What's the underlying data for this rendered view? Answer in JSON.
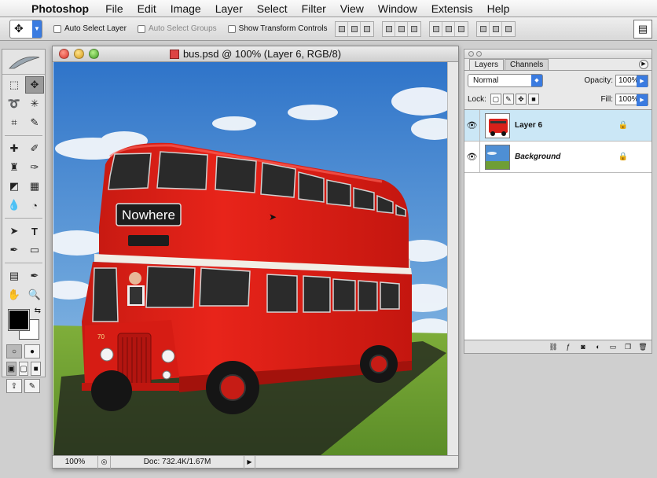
{
  "menubar": {
    "app": "Photoshop",
    "items": [
      "File",
      "Edit",
      "Image",
      "Layer",
      "Select",
      "Filter",
      "View",
      "Window",
      "Extensis",
      "Help"
    ]
  },
  "options": {
    "auto_select_layer": "Auto Select Layer",
    "auto_select_groups": "Auto Select Groups",
    "show_transform_controls": "Show Transform Controls"
  },
  "document": {
    "title": "bus.psd @ 100% (Layer 6, RGB/8)",
    "zoom": "100%",
    "doc_info": "Doc: 732.4K/1.67M",
    "sign_text": "Nowhere",
    "fleet_number": "70"
  },
  "layers_panel": {
    "tabs": [
      "Layers",
      "Channels"
    ],
    "active_tab": "Layers",
    "blend_mode": "Normal",
    "opacity_label": "Opacity:",
    "opacity": "100%",
    "lock_label": "Lock:",
    "fill_label": "Fill:",
    "fill": "100%",
    "layers": [
      {
        "name": "Layer 6",
        "selected": true,
        "visible": true,
        "locked": true
      },
      {
        "name": "Background",
        "selected": false,
        "visible": true,
        "locked": true
      }
    ]
  },
  "colors": {
    "foreground": "#000000",
    "background": "#ffffff",
    "selected_layer_bg": "#cbe7f6",
    "bus_red": "#e01a12"
  }
}
